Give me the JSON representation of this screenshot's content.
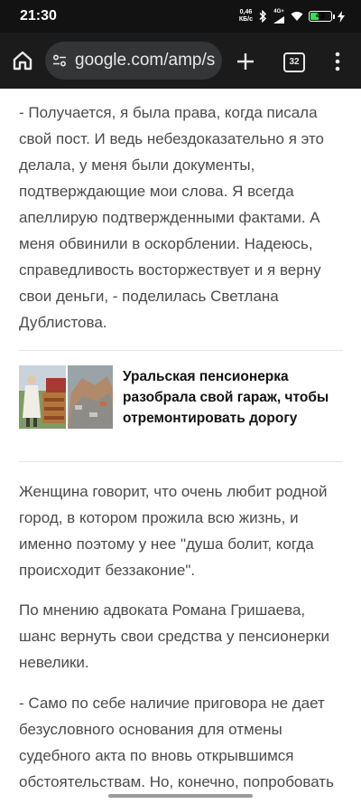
{
  "status_bar": {
    "time": "21:30",
    "net_speed_value": "0,46",
    "net_speed_unit": "КБ/с",
    "signal_label": "4G+",
    "battery": "43",
    "battery_level": 0.43,
    "icons": [
      "bluetooth-icon",
      "signal-icon",
      "wifi-icon",
      "battery-icon",
      "charging-icon"
    ]
  },
  "browser": {
    "url": "google.com/amp/s",
    "tab_count": "32",
    "icons": [
      "home-icon",
      "site-settings-icon",
      "plus-icon",
      "more-vert-icon"
    ]
  },
  "article": {
    "paragraphs_top": [
      "- Получается, я была права, когда писала свой пост. И ведь небездоказательно я это делала, у меня были документы, подтверждающие мои слова. Я всегда апеллирую подтвержденными фактами. А меня обвинили в оскорблении. Надеюсь, справедливость восторжествует и я верну свои деньги, - поделилась Светлана Дублистова."
    ],
    "related": {
      "title": "Уральская пенсионерка разобрала свой гараж, чтобы отремонтировать дорогу"
    },
    "paragraphs_bottom": [
      "Женщина говорит, что очень любит родной город, в котором прожила всю жизнь, и именно поэтому у нее \"душа болит, когда происходит беззаконие\".",
      "По мнению адвоката Романа Гришаева, шанс вернуть свои средства у пенсионерки невелики.",
      "- Само по себе наличие приговора не дает безусловного основания для отмены судебного акта по вновь открывшимся обстоятельствам. Но, конечно, попробовать"
    ]
  },
  "colors": {
    "status_bg": "#121212",
    "toolbar_bg": "#1b1b1b",
    "omnibox_bg": "#333537",
    "body_text": "#4b4b4b",
    "heading_text": "#111111",
    "battery_green": "#3ddc52"
  }
}
